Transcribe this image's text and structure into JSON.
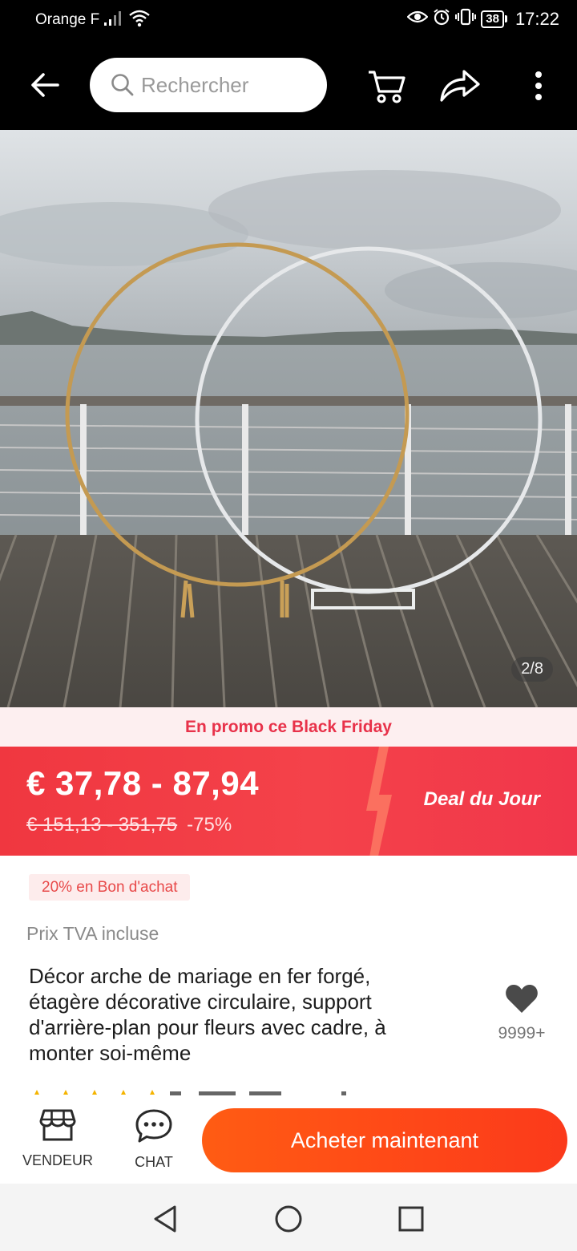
{
  "status_bar": {
    "carrier": "Orange F",
    "battery": "38",
    "time": "17:22"
  },
  "app_bar": {
    "search_placeholder": "Rechercher",
    "icons": [
      "back-arrow-icon",
      "search-icon",
      "cart-icon",
      "share-icon",
      "more-vertical-icon"
    ]
  },
  "gallery": {
    "counter": "2/8"
  },
  "promo": {
    "label": "En promo ce Black Friday"
  },
  "price": {
    "current": "€ 37,78 - 87,94",
    "original": "€ 151,13 - 351,75",
    "discount": "-75%",
    "deal_label": "Deal du Jour"
  },
  "coupon": {
    "label": "20% en Bon d'achat"
  },
  "tax_note": "Prix TVA incluse",
  "product": {
    "title": "Décor arche de mariage en fer forgé, étagère décorative circulaire, support d'arrière-plan pour fleurs avec cadre, à monter soi-même",
    "wishlist_count": "9999+"
  },
  "action_bar": {
    "vendor_label": "VENDEUR",
    "chat_label": "CHAT",
    "buy_label": "Acheter maintenant"
  },
  "colors": {
    "accent_red": "#f03740",
    "buy_orange": "#ff5c13",
    "promo_text": "#e8324a"
  }
}
